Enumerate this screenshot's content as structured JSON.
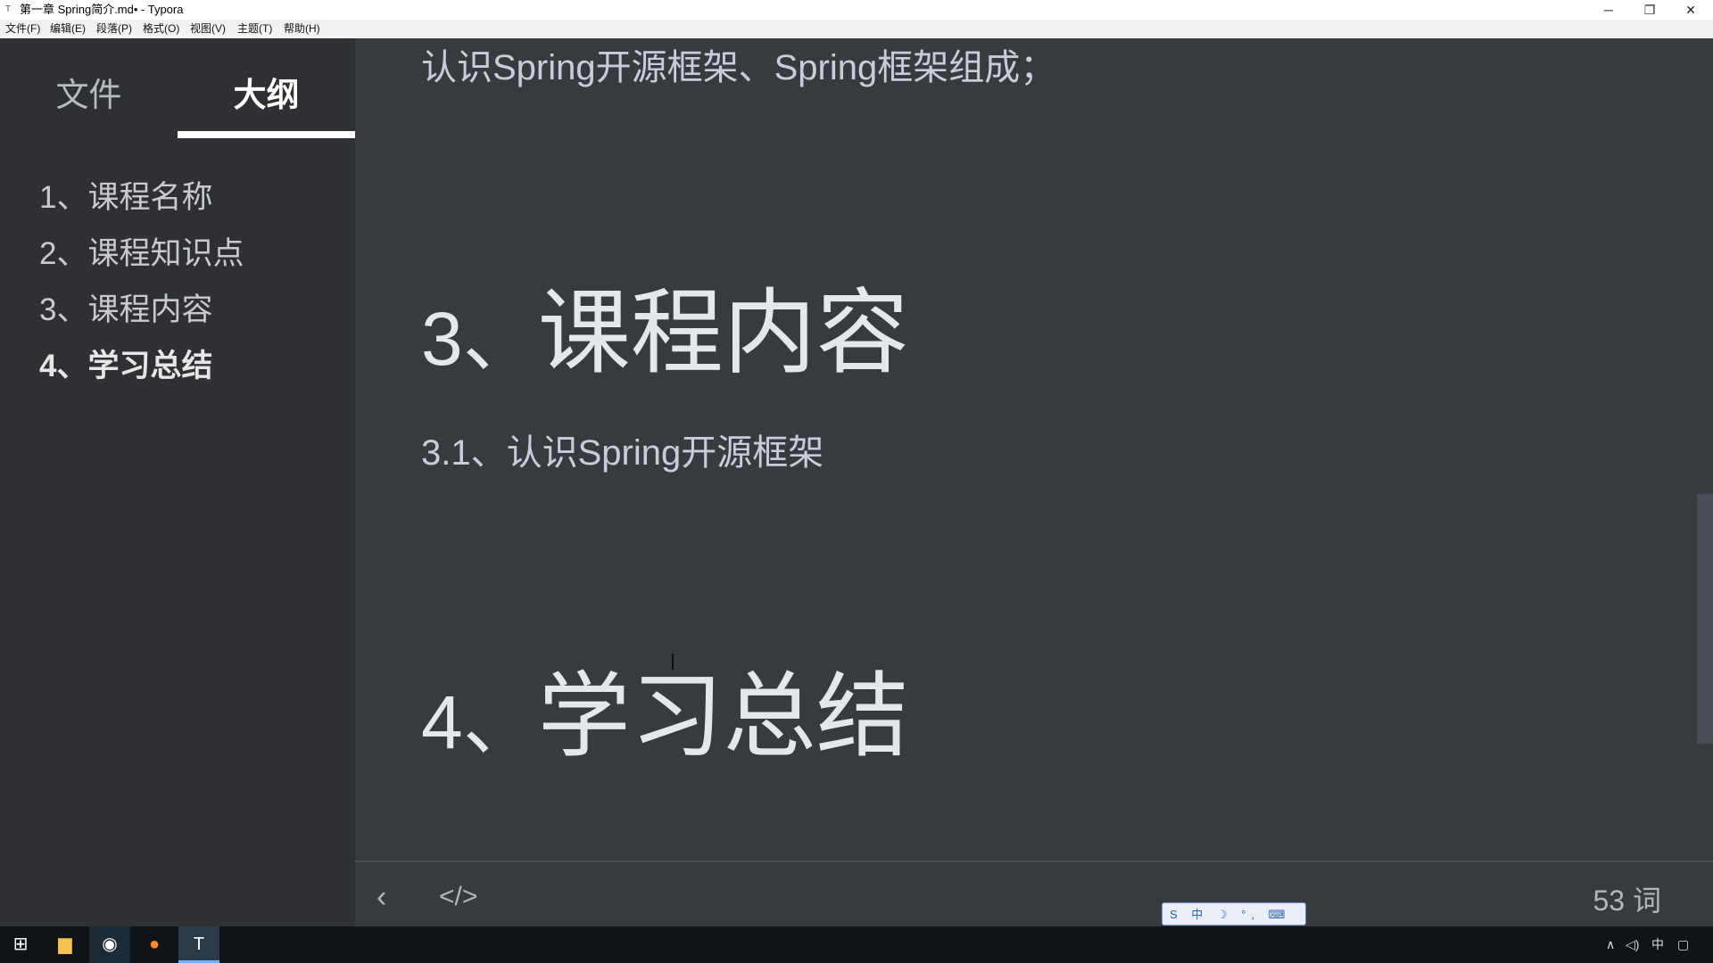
{
  "window": {
    "title": "第一章 Spring简介.md• - Typora",
    "app_icon": "typora-icon",
    "controls": {
      "minimize": "─",
      "maximize": "❐",
      "close": "✕"
    }
  },
  "menu": [
    {
      "label": "文件(F)"
    },
    {
      "label": "编辑(E)"
    },
    {
      "label": "段落(P)"
    },
    {
      "label": "格式(O)"
    },
    {
      "label": "视图(V)"
    },
    {
      "label": "主题(T)"
    },
    {
      "label": "帮助(H)"
    }
  ],
  "sidebar": {
    "tabs": [
      {
        "label": "文件"
      },
      {
        "label": "大纲",
        "active": true
      }
    ],
    "outline": [
      {
        "label": "1、课程名称"
      },
      {
        "label": "2、课程知识点"
      },
      {
        "label": "3、课程内容"
      },
      {
        "label": "4、学习总结",
        "active": true
      }
    ]
  },
  "content": {
    "top_line": "认识Spring开源框架、Spring框架组成；",
    "heading3_num": "3、",
    "heading3_text": "课程内容",
    "sub31": "3.1、认识Spring开源框架",
    "heading4_num": "4、",
    "heading4_text": "学习总结"
  },
  "footer": {
    "back_icon": "chevron-left-icon",
    "back_glyph": "‹",
    "code_icon": "code-icon",
    "code_glyph": "</>",
    "word_count": "53 词"
  },
  "ime_toolbar": {
    "glyphs": "S 中 ☽ °, ⌨ ⚘ ✎"
  },
  "taskbar": {
    "start_glyph": "⊞",
    "explorer_glyph": "▆",
    "chrome_glyph": "◉",
    "firefox_glyph": "●",
    "typora_glyph": "T",
    "tray_up": "∧",
    "tray_volume": "◁)",
    "tray_lang": "中",
    "tray_notify": "▢"
  }
}
